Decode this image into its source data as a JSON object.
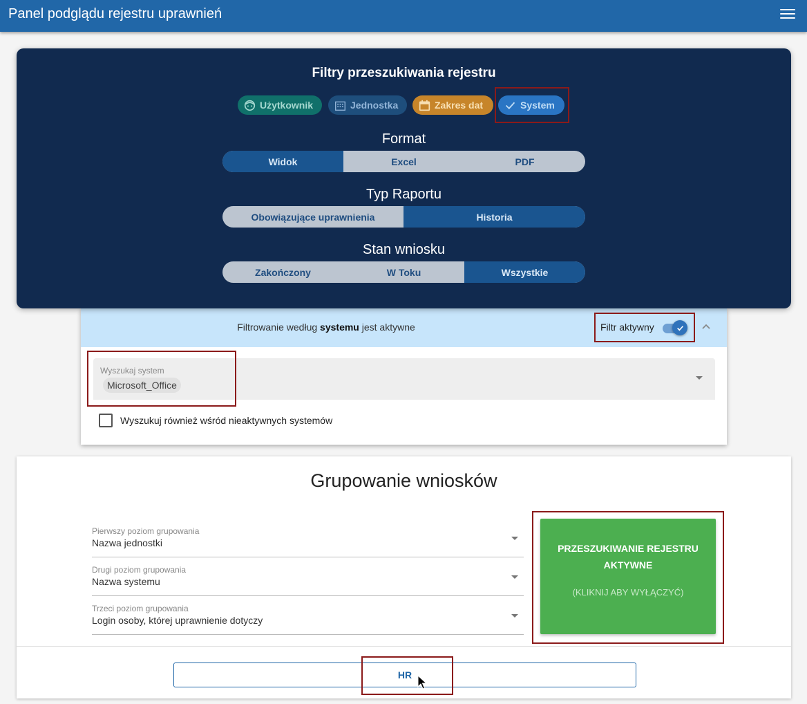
{
  "appbar": {
    "title": "Panel podglądu rejestru uprawnień",
    "menu_icon": "menu-icon"
  },
  "filters": {
    "title": "Filtry przeszukiwania rejestru",
    "chips": [
      {
        "label": "Użytkownik",
        "icon": "face-icon",
        "color": "#10706a"
      },
      {
        "label": "Jednostka",
        "icon": "building-icon",
        "color": "#1e4e7c"
      },
      {
        "label": "Zakres dat",
        "icon": "calendar-icon",
        "color": "#c7852a"
      },
      {
        "label": "System",
        "icon": "check-icon",
        "color": "#2a75c4"
      }
    ],
    "format": {
      "label": "Format",
      "options": [
        "Widok",
        "Excel",
        "PDF"
      ],
      "selected": "Widok"
    },
    "report_type": {
      "label": "Typ Raportu",
      "options": [
        "Obowiązujące uprawnienia",
        "Historia"
      ],
      "selected": "Historia"
    },
    "request_state": {
      "label": "Stan wniosku",
      "options": [
        "Zakończony",
        "W Toku",
        "Wszystkie"
      ],
      "selected": "Wszystkie"
    }
  },
  "system_filter": {
    "message_prefix": "Filtrowanie według",
    "message_bold": "systemu",
    "message_suffix": "jest aktywne",
    "active_label": "Filtr aktywny",
    "toggle_on": true,
    "search_label": "Wyszukaj system",
    "selected_system": "Microsoft_Office",
    "inactive_checkbox_label": "Wyszukuj również wśród nieaktywnych systemów",
    "inactive_checked": false
  },
  "grouping": {
    "title": "Grupowanie wniosków",
    "levels": [
      {
        "label": "Pierwszy poziom grupowania",
        "value": "Nazwa jednostki"
      },
      {
        "label": "Drugi poziom grupowania",
        "value": "Nazwa systemu"
      },
      {
        "label": "Trzeci poziom grupowania",
        "value": "Login osoby, której uprawnienie dotyczy"
      }
    ],
    "search_button": {
      "main": "PRZESZUKIWANIE REJESTRU AKTYWNE",
      "sub": "(KLIKNIJ ABY WYŁĄCZYĆ)",
      "color": "#4caf50"
    },
    "hr_button": "HR"
  },
  "colors": {
    "appbar": "#2167a8",
    "panel": "#112a4f",
    "highlight": "#8b1a1a"
  }
}
